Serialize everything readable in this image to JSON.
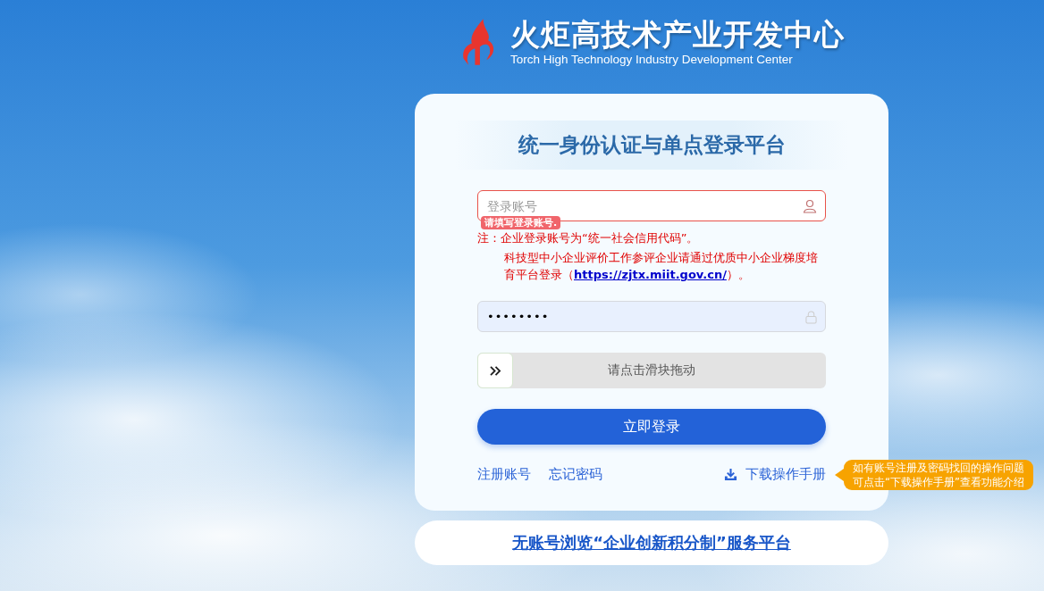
{
  "header": {
    "title": "火炬高技术产业开发中心",
    "subtitle": "Torch High Technology Industry Development Center"
  },
  "login": {
    "title": "统一身份认证与单点登录平台",
    "account_field": {
      "placeholder": "登录账号",
      "invalid": true,
      "error": "请填写登录账号."
    },
    "notes": [
      {
        "text": "注：企业登录账号为“统一社会信用代码”。"
      },
      {
        "text": "科技型中小企业评价工作参评企业请通过优质中小企业梯度培育平台登录（",
        "link": "https://zjtx.miit.gov.cn/",
        "after": "）。"
      }
    ],
    "password_field": {
      "value": "••••••••"
    },
    "slider": {
      "label": "请点击滑块拖动",
      "level": 0
    },
    "submit": "立即登录",
    "links": [
      "注册账号",
      "忘记密码"
    ],
    "download": "下载操作手册",
    "tooltip": [
      "如有账号注册及密码找回的操作问题",
      "可点击“下载操作手册”查看功能介绍"
    ]
  },
  "browse_link": "无账号浏览“企业创新积分制”服务平台"
}
